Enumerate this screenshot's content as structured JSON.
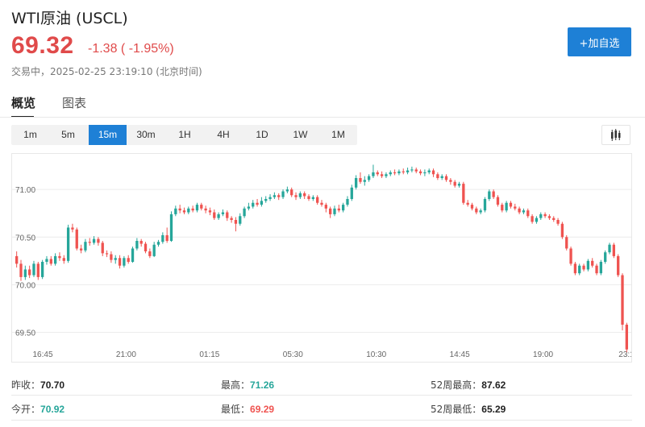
{
  "header": {
    "title": "WTI原油 (USCL)",
    "price": "69.32",
    "change": "-1.38 ( -1.95%)",
    "status": "交易中，2025-02-25 23:19:10 (北京时间)",
    "add_label": "+加自选"
  },
  "tabs": [
    {
      "label": "概览",
      "active": true
    },
    {
      "label": "图表",
      "active": false
    }
  ],
  "intervals": [
    {
      "label": "1m",
      "active": false
    },
    {
      "label": "5m",
      "active": false
    },
    {
      "label": "15m",
      "active": true
    },
    {
      "label": "30m",
      "active": false
    },
    {
      "label": "1H",
      "active": false
    },
    {
      "label": "4H",
      "active": false
    },
    {
      "label": "1D",
      "active": false
    },
    {
      "label": "1W",
      "active": false
    },
    {
      "label": "1M",
      "active": false
    }
  ],
  "icons": {
    "chart_type": "candlestick-icon"
  },
  "colors": {
    "up": "#26a69a",
    "down": "#ef5350",
    "accent": "#1e80d6"
  },
  "stats": {
    "prev_close_label": "昨收：",
    "prev_close": "70.70",
    "open_label": "今开：",
    "open": "70.92",
    "high_label": "最高：",
    "high": "71.26",
    "low_label": "最低：",
    "low": "69.29",
    "w52_high_label": "52周最高：",
    "w52_high": "87.62",
    "w52_low_label": "52周最低：",
    "w52_low": "65.29"
  },
  "chart_data": {
    "type": "candlestick",
    "interval": "15m",
    "x_tick_labels": [
      "16:45",
      "21:00",
      "01:15",
      "05:30",
      "10:30",
      "14:45",
      "19:00",
      "23:1"
    ],
    "y_tick_labels": [
      "71.00",
      "70.50",
      "70.00",
      "69.50"
    ],
    "ylim": [
      69.36,
      71.34
    ],
    "grid": "horizontal",
    "candles": [
      [
        70.3,
        70.22,
        70.35,
        70.18
      ],
      [
        70.22,
        70.08,
        70.26,
        70.04
      ],
      [
        70.08,
        70.16,
        70.2,
        70.05
      ],
      [
        70.16,
        70.1,
        70.2,
        70.07
      ],
      [
        70.1,
        70.22,
        70.25,
        70.08
      ],
      [
        70.22,
        70.08,
        70.24,
        70.05
      ],
      [
        70.08,
        70.24,
        70.26,
        70.06
      ],
      [
        70.24,
        70.27,
        70.3,
        70.21
      ],
      [
        70.27,
        70.22,
        70.3,
        70.2
      ],
      [
        70.22,
        70.3,
        70.33,
        70.2
      ],
      [
        70.3,
        70.28,
        70.34,
        70.25
      ],
      [
        70.28,
        70.25,
        70.31,
        70.22
      ],
      [
        70.25,
        70.6,
        70.63,
        70.23
      ],
      [
        70.6,
        70.58,
        70.64,
        70.55
      ],
      [
        70.58,
        70.38,
        70.6,
        70.36
      ],
      [
        70.38,
        70.36,
        70.42,
        70.33
      ],
      [
        70.36,
        70.45,
        70.48,
        70.34
      ],
      [
        70.45,
        70.44,
        70.49,
        70.41
      ],
      [
        70.44,
        70.48,
        70.51,
        70.42
      ],
      [
        70.48,
        70.44,
        70.5,
        70.41
      ],
      [
        70.44,
        70.33,
        70.46,
        70.3
      ],
      [
        70.33,
        70.32,
        70.36,
        70.29
      ],
      [
        70.32,
        70.26,
        70.35,
        70.23
      ],
      [
        70.26,
        70.28,
        70.31,
        70.22
      ],
      [
        70.28,
        70.2,
        70.31,
        70.17
      ],
      [
        70.2,
        70.28,
        70.3,
        70.18
      ],
      [
        70.28,
        70.24,
        70.31,
        70.22
      ],
      [
        70.24,
        70.38,
        70.4,
        70.23
      ],
      [
        70.38,
        70.46,
        70.49,
        70.36
      ],
      [
        70.46,
        70.43,
        70.48,
        70.4
      ],
      [
        70.43,
        70.35,
        70.45,
        70.33
      ],
      [
        70.35,
        70.3,
        70.38,
        70.28
      ],
      [
        70.3,
        70.42,
        70.45,
        70.29
      ],
      [
        70.42,
        70.45,
        70.47,
        70.4
      ],
      [
        70.45,
        70.52,
        70.55,
        70.43
      ],
      [
        70.52,
        70.46,
        70.6,
        70.44
      ],
      [
        70.46,
        70.74,
        70.77,
        70.45
      ],
      [
        70.74,
        70.8,
        70.83,
        70.72
      ],
      [
        70.8,
        70.78,
        70.84,
        70.75
      ],
      [
        70.78,
        70.76,
        70.81,
        70.74
      ],
      [
        70.76,
        70.8,
        70.82,
        70.74
      ],
      [
        70.8,
        70.78,
        70.83,
        70.76
      ],
      [
        70.78,
        70.84,
        70.86,
        70.76
      ],
      [
        70.84,
        70.8,
        70.86,
        70.78
      ],
      [
        70.8,
        70.78,
        70.83,
        70.75
      ],
      [
        70.78,
        70.76,
        70.81,
        70.73
      ],
      [
        70.76,
        70.7,
        70.79,
        70.68
      ],
      [
        70.7,
        70.74,
        70.76,
        70.68
      ],
      [
        70.74,
        70.76,
        70.79,
        70.72
      ],
      [
        70.76,
        70.7,
        70.78,
        70.67
      ],
      [
        70.7,
        70.68,
        70.72,
        70.65
      ],
      [
        70.68,
        70.64,
        70.71,
        70.56
      ],
      [
        70.64,
        70.72,
        70.75,
        70.62
      ],
      [
        70.72,
        70.8,
        70.82,
        70.7
      ],
      [
        70.8,
        70.82,
        70.86,
        70.78
      ],
      [
        70.82,
        70.86,
        70.89,
        70.8
      ],
      [
        70.86,
        70.84,
        70.9,
        70.82
      ],
      [
        70.84,
        70.88,
        70.92,
        70.82
      ],
      [
        70.88,
        70.9,
        70.93,
        70.86
      ],
      [
        70.9,
        70.92,
        70.95,
        70.88
      ],
      [
        70.92,
        70.94,
        70.97,
        70.9
      ],
      [
        70.94,
        70.92,
        70.96,
        70.89
      ],
      [
        70.92,
        70.98,
        71.0,
        70.9
      ],
      [
        70.98,
        71.0,
        71.03,
        70.96
      ],
      [
        71.0,
        70.94,
        71.02,
        70.92
      ],
      [
        70.94,
        70.92,
        70.97,
        70.89
      ],
      [
        70.92,
        70.96,
        70.98,
        70.9
      ],
      [
        70.96,
        70.93,
        70.98,
        70.9
      ],
      [
        70.93,
        70.9,
        70.95,
        70.88
      ],
      [
        70.9,
        70.92,
        70.94,
        70.88
      ],
      [
        70.92,
        70.86,
        70.94,
        70.84
      ],
      [
        70.86,
        70.84,
        70.89,
        70.82
      ],
      [
        70.84,
        70.8,
        70.86,
        70.76
      ],
      [
        70.8,
        70.74,
        70.82,
        70.7
      ],
      [
        70.74,
        70.8,
        70.83,
        70.72
      ],
      [
        70.8,
        70.78,
        70.84,
        70.76
      ],
      [
        70.78,
        70.84,
        70.86,
        70.76
      ],
      [
        70.84,
        70.9,
        70.93,
        70.82
      ],
      [
        70.9,
        71.02,
        71.05,
        70.88
      ],
      [
        71.02,
        71.12,
        71.15,
        71.0
      ],
      [
        71.12,
        71.08,
        71.18,
        71.06
      ],
      [
        71.08,
        71.1,
        71.14,
        71.04
      ],
      [
        71.1,
        71.14,
        71.16,
        71.08
      ],
      [
        71.14,
        71.18,
        71.26,
        71.12
      ],
      [
        71.18,
        71.16,
        71.2,
        71.14
      ],
      [
        71.16,
        71.14,
        71.19,
        71.12
      ],
      [
        71.14,
        71.16,
        71.18,
        71.12
      ],
      [
        71.16,
        71.18,
        71.2,
        71.14
      ],
      [
        71.18,
        71.17,
        71.21,
        71.15
      ],
      [
        71.17,
        71.19,
        71.21,
        71.15
      ],
      [
        71.19,
        71.18,
        71.22,
        71.16
      ],
      [
        71.18,
        71.2,
        71.23,
        71.16
      ],
      [
        71.2,
        71.21,
        71.24,
        71.18
      ],
      [
        71.21,
        71.19,
        71.23,
        71.17
      ],
      [
        71.19,
        71.17,
        71.21,
        71.15
      ],
      [
        71.17,
        71.18,
        71.21,
        71.14
      ],
      [
        71.18,
        71.2,
        71.22,
        71.16
      ],
      [
        71.2,
        71.16,
        71.22,
        71.13
      ],
      [
        71.16,
        71.12,
        71.18,
        71.1
      ],
      [
        71.12,
        71.14,
        71.16,
        71.1
      ],
      [
        71.14,
        71.1,
        71.16,
        71.08
      ],
      [
        71.1,
        71.08,
        71.12,
        71.05
      ],
      [
        71.08,
        71.04,
        71.1,
        71.02
      ],
      [
        71.04,
        71.06,
        71.08,
        71.02
      ],
      [
        71.06,
        70.86,
        71.08,
        70.84
      ],
      [
        70.86,
        70.84,
        70.89,
        70.82
      ],
      [
        70.84,
        70.8,
        70.86,
        70.78
      ],
      [
        70.8,
        70.76,
        70.82,
        70.74
      ],
      [
        70.76,
        70.78,
        70.8,
        70.74
      ],
      [
        70.78,
        70.9,
        70.92,
        70.76
      ],
      [
        70.9,
        70.98,
        71.0,
        70.88
      ],
      [
        70.98,
        70.92,
        71.0,
        70.9
      ],
      [
        70.92,
        70.84,
        70.94,
        70.82
      ],
      [
        70.84,
        70.78,
        70.86,
        70.76
      ],
      [
        70.78,
        70.86,
        70.88,
        70.76
      ],
      [
        70.86,
        70.82,
        70.88,
        70.8
      ],
      [
        70.82,
        70.8,
        70.85,
        70.78
      ],
      [
        70.8,
        70.76,
        70.82,
        70.74
      ],
      [
        70.76,
        70.78,
        70.8,
        70.74
      ],
      [
        70.78,
        70.72,
        70.8,
        70.7
      ],
      [
        70.72,
        70.66,
        70.74,
        70.64
      ],
      [
        70.66,
        70.7,
        70.72,
        70.64
      ],
      [
        70.7,
        70.74,
        70.76,
        70.68
      ],
      [
        70.74,
        70.72,
        70.76,
        70.7
      ],
      [
        70.72,
        70.7,
        70.74,
        70.68
      ],
      [
        70.7,
        70.68,
        70.72,
        70.66
      ],
      [
        70.68,
        70.64,
        70.7,
        70.62
      ],
      [
        70.64,
        70.5,
        70.66,
        70.48
      ],
      [
        70.5,
        70.38,
        70.52,
        70.36
      ],
      [
        70.38,
        70.22,
        70.4,
        70.2
      ],
      [
        70.22,
        70.12,
        70.24,
        70.1
      ],
      [
        70.12,
        70.2,
        70.22,
        70.1
      ],
      [
        70.2,
        70.16,
        70.22,
        70.14
      ],
      [
        70.16,
        70.25,
        70.27,
        70.14
      ],
      [
        70.25,
        70.2,
        70.28,
        70.18
      ],
      [
        70.2,
        70.12,
        70.22,
        70.1
      ],
      [
        70.12,
        70.24,
        70.26,
        70.1
      ],
      [
        70.24,
        70.34,
        70.36,
        70.22
      ],
      [
        70.34,
        70.42,
        70.44,
        70.32
      ],
      [
        70.42,
        70.3,
        70.44,
        70.28
      ],
      [
        70.3,
        70.1,
        70.32,
        70.08
      ],
      [
        70.1,
        69.58,
        70.12,
        69.52
      ],
      [
        69.58,
        69.32,
        69.6,
        69.29
      ]
    ]
  }
}
